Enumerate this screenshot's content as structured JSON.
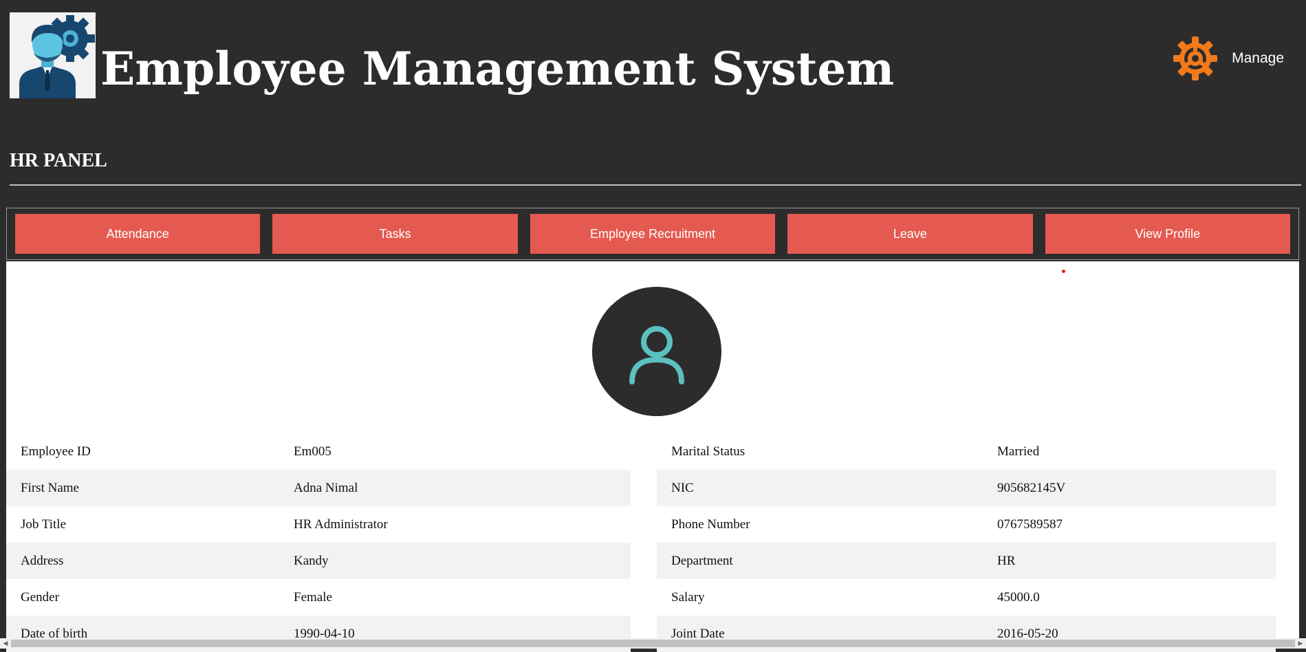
{
  "header": {
    "title": "Employee Management System",
    "manage_label": "Manage",
    "logo_icon": "employee-gear-logo",
    "manage_icon": "gear-icon",
    "accent_color": "#f27a1a"
  },
  "panel": {
    "title": "HR PANEL"
  },
  "nav": {
    "button_color": "#e55a50",
    "items": [
      {
        "label": "Attendance"
      },
      {
        "label": "Tasks"
      },
      {
        "label": "Employee Recruitment"
      },
      {
        "label": "Leave"
      },
      {
        "label": "View Profile"
      }
    ]
  },
  "profile": {
    "avatar_icon": "user-icon",
    "avatar_icon_color": "#5bc0c0",
    "left": [
      {
        "label": "Employee ID",
        "value": "Em005"
      },
      {
        "label": "First Name",
        "value": "Adna Nimal"
      },
      {
        "label": "Job Title",
        "value": "HR Administrator"
      },
      {
        "label": "Address",
        "value": "Kandy"
      },
      {
        "label": "Gender",
        "value": "Female"
      },
      {
        "label": "Date of birth",
        "value": "1990-04-10"
      }
    ],
    "right": [
      {
        "label": "Marital Status",
        "value": "Married"
      },
      {
        "label": "NIC",
        "value": "905682145V"
      },
      {
        "label": "Phone Number",
        "value": "0767589587"
      },
      {
        "label": "Department",
        "value": "HR"
      },
      {
        "label": "Salary",
        "value": "45000.0"
      },
      {
        "label": "Joint Date",
        "value": "2016-05-20"
      }
    ]
  }
}
